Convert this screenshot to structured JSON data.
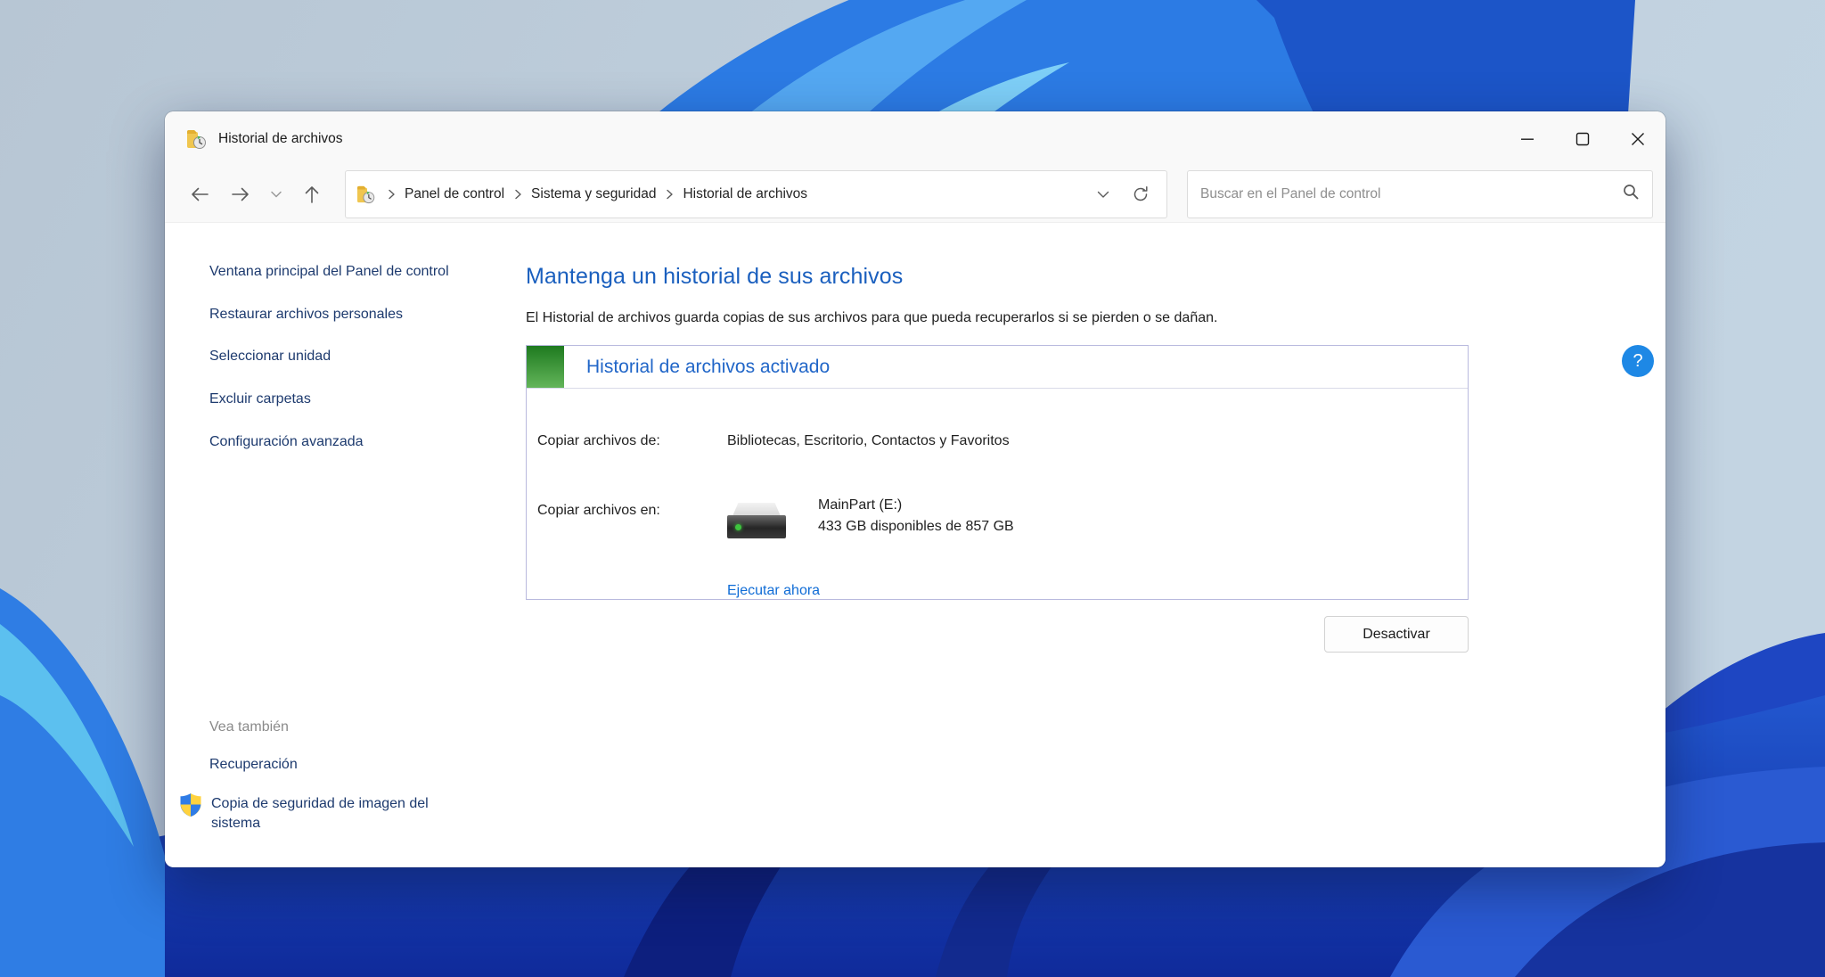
{
  "window": {
    "title": "Historial de archivos"
  },
  "icons": {
    "app": "folder-history-icon",
    "back": "arrow-left-icon",
    "forward": "arrow-right-icon",
    "recent_pages": "chevron-down-icon",
    "up": "arrow-up-icon",
    "breadcrumb_separator": "chevron-right-icon",
    "address_dropdown": "chevron-down-icon",
    "refresh": "refresh-icon",
    "search": "magnifier-icon",
    "help": "question-mark-icon",
    "shield": "uac-shield-icon",
    "drive": "hard-drive-icon",
    "minimize": "minimize-icon",
    "maximize": "maximize-icon",
    "close": "close-icon"
  },
  "toolbar": {
    "breadcrumb": {
      "items": [
        {
          "label": "Panel de control"
        },
        {
          "label": "Sistema y seguridad"
        },
        {
          "label": "Historial de archivos"
        }
      ]
    },
    "search": {
      "placeholder": "Buscar en el Panel de control"
    }
  },
  "sidebar": {
    "items": [
      {
        "label": "Ventana principal del Panel de control"
      },
      {
        "label": "Restaurar archivos personales"
      },
      {
        "label": "Seleccionar unidad"
      },
      {
        "label": "Excluir carpetas"
      },
      {
        "label": "Configuración avanzada"
      }
    ],
    "see_also": {
      "header": "Vea también",
      "items": [
        {
          "label": "Recuperación"
        },
        {
          "label": "Copia de seguridad de imagen del sistema"
        }
      ]
    }
  },
  "main": {
    "heading": "Mantenga un historial de sus archivos",
    "description": "El Historial de archivos guarda copias de sus archivos para que pueda recuperarlos si se pierden o se dañan.",
    "status_panel": {
      "status_label": "Historial de archivos activado",
      "copy_from_label": "Copiar archivos de:",
      "copy_from_value": "Bibliotecas, Escritorio, Contactos y Favoritos",
      "copy_to_label": "Copiar archivos en:",
      "drive_name": "MainPart (E:)",
      "drive_space": "433 GB disponibles de 857 GB",
      "run_now_label": "Ejecutar ahora"
    },
    "disable_button_label": "Desactivar",
    "help_button_label": "?"
  },
  "colors": {
    "heading_blue": "#1a5fbe",
    "status_text_blue": "#2166c8",
    "link_blue": "#0f6cd6",
    "sidebar_link_navy": "#1d3a6e",
    "status_green_top": "#1e7a1f",
    "status_green_bottom": "#63b55a",
    "help_blue": "#1e88e5"
  }
}
